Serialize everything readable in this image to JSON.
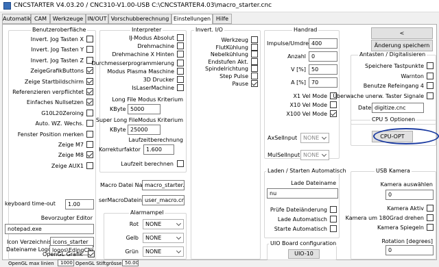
{
  "window": {
    "title": "CNCSTARTER V4.03.20 / CNC310-V1.00-USB     C:\\CNCSTARTER4.03\\macro_starter.cnc"
  },
  "tabs": [
    "Automatik",
    "CAM",
    "Werkzeuge",
    "IN/OUT",
    "Vorschubberechnung",
    "Einstellungen",
    "Hilfe"
  ],
  "ui": {
    "title": "Benutzeroberfläche",
    "checks": [
      {
        "label": "Invert. Jog Tasten X",
        "checked": false
      },
      {
        "label": "Invert. Jog Tasten Y",
        "checked": false
      },
      {
        "label": "Invert. Jog Tasten Z",
        "checked": false
      },
      {
        "label": "ZeigeGrafikButtons",
        "checked": true
      },
      {
        "label": "Zeige Startbildschirm",
        "checked": true
      },
      {
        "label": "Referenzieren verpflichtet",
        "checked": true
      },
      {
        "label": "Einfaches Nullsetzen",
        "checked": true
      },
      {
        "label": "G10L20Zeroing",
        "checked": false
      },
      {
        "label": "Auto. WZ. Wechs.",
        "checked": false
      },
      {
        "label": "Fenster Position merken",
        "checked": false
      },
      {
        "label": "Zeige M7",
        "checked": false
      },
      {
        "label": "Zeige M8",
        "checked": true
      },
      {
        "label": "Zeige AUX1",
        "checked": false
      }
    ],
    "keyboard_timeout_label": "keyboard time-out",
    "keyboard_timeout": "1.00",
    "editor_label": "Bevorzugter Editor",
    "editor": "notepad.exe",
    "icon_dir_label": "Icon Verzeichnis",
    "icon_dir": "icons_starter",
    "logo_label": "Dateiname Logo",
    "logo": "logos\\EdingCNCL",
    "opengl_label": "OpenGL Grafik",
    "opengl_checked": true,
    "opengl_max_label": "OpenGL max linien",
    "opengl_max": "1000",
    "opengl_pen_label": "OpenGL Stiftgrösse",
    "opengl_pen": "50.00"
  },
  "interp": {
    "title": "Interpreter",
    "checks": [
      {
        "label": "IJ-Modus Absolut",
        "checked": false
      },
      {
        "label": "Drehmachine",
        "checked": false
      },
      {
        "label": "Drehmachine X Hinten",
        "checked": false
      },
      {
        "label": "Durchmesserprogrammierung",
        "checked": false
      },
      {
        "label": "Modus Plasma Maschine",
        "checked": false
      },
      {
        "label": "3D Drucker",
        "checked": false
      },
      {
        "label": "IsLaserMachine",
        "checked": false
      }
    ],
    "long_file_label": "Long File Modus Kriterium",
    "kbyte_label": "KByte",
    "long_file": "5000",
    "super_long_label": "Super Long FileModus Kriterium",
    "super_long": "25000",
    "laufzeit_label": "Laufzeitberechnung",
    "korrektur_label": "Korrekturfaktor",
    "korrektur": "1.600",
    "laufzeit_calc_label": "Laufzeit berechnen",
    "macro_label": "Macro Datei Name",
    "macro": "macro_starter.cr",
    "user_macro_label": "serMacroDateiname",
    "user_macro": "user_macro.cnc"
  },
  "alarm": {
    "title": "Alarmampel",
    "rows": [
      {
        "label": "Rot",
        "value": "NONE"
      },
      {
        "label": "Gelb",
        "value": "NONE"
      },
      {
        "label": "Grün",
        "value": "NONE"
      }
    ]
  },
  "io": {
    "title": "Invert. I/O",
    "checks": [
      {
        "label": "Werkzeug",
        "checked": false
      },
      {
        "label": "FlutKühlung",
        "checked": false
      },
      {
        "label": "Nebelkühlung",
        "checked": false
      },
      {
        "label": "Endstufen Akt.",
        "checked": false
      },
      {
        "label": "Spindelrichtung",
        "checked": false
      },
      {
        "label": "Step Pulse",
        "checked": false
      },
      {
        "label": "Pause",
        "checked": true
      }
    ]
  },
  "handrad": {
    "title": "Handrad",
    "imp_label": "Impulse/Umdreh.",
    "imp": "400",
    "anzahl_label": "Anzahl",
    "anzahl": "0",
    "v_label": "V [%]",
    "v": "50",
    "a_label": "A [%]",
    "a": "70",
    "vel": [
      {
        "label": "X1 Vel Mode",
        "checked": false
      },
      {
        "label": "X10 Vel Mode",
        "checked": false
      },
      {
        "label": "X100 Vel Mode",
        "checked": true
      }
    ],
    "axsel_label": "AxSelInput",
    "axsel": "NONE",
    "mulsel_label": "MulSelInput",
    "mulsel": "NONE"
  },
  "right": {
    "back": "<",
    "save": "Änderung speichern",
    "antasten_title": "Antasten / Digitalisieren",
    "checks": [
      {
        "label": "Speichere Tastpunkte",
        "checked": false
      },
      {
        "label": "Warnton",
        "checked": false
      },
      {
        "label": "Benutze Refeingang 4",
        "checked": false
      },
      {
        "label": "Überwache unerw. Taster Signale",
        "checked": false
      }
    ],
    "datei_label": "Datei",
    "datei": "digitize.cnc",
    "cpu_title": "CPU 5 Optionen",
    "cpu_btn": "CPU-OPT"
  },
  "load": {
    "title": "Laden / Starten Automatisch",
    "file_label": "Lade Dateiname",
    "file": "nu",
    "checks": [
      {
        "label": "Prüfe Dateiänderung",
        "checked": false
      },
      {
        "label": "Lade Automatisch",
        "checked": false
      },
      {
        "label": "Starte Automatisch",
        "checked": false
      }
    ]
  },
  "uio": {
    "title": "UIO Board configuration",
    "btn": "UIO-10"
  },
  "usb": {
    "title": "USB Kamera",
    "select_label": "Kamera auswählen",
    "select_val": "0",
    "checks": [
      {
        "label": "Kamera Aktiv",
        "checked": false
      },
      {
        "label": "Kamera um 180Grad drehen",
        "checked": false
      },
      {
        "label": "Kamera Spiegeln",
        "checked": false
      }
    ],
    "rot_label": "Rotation [degrees]",
    "rot": "0"
  },
  "colors": {
    "highlight": "#1a3aa0"
  }
}
